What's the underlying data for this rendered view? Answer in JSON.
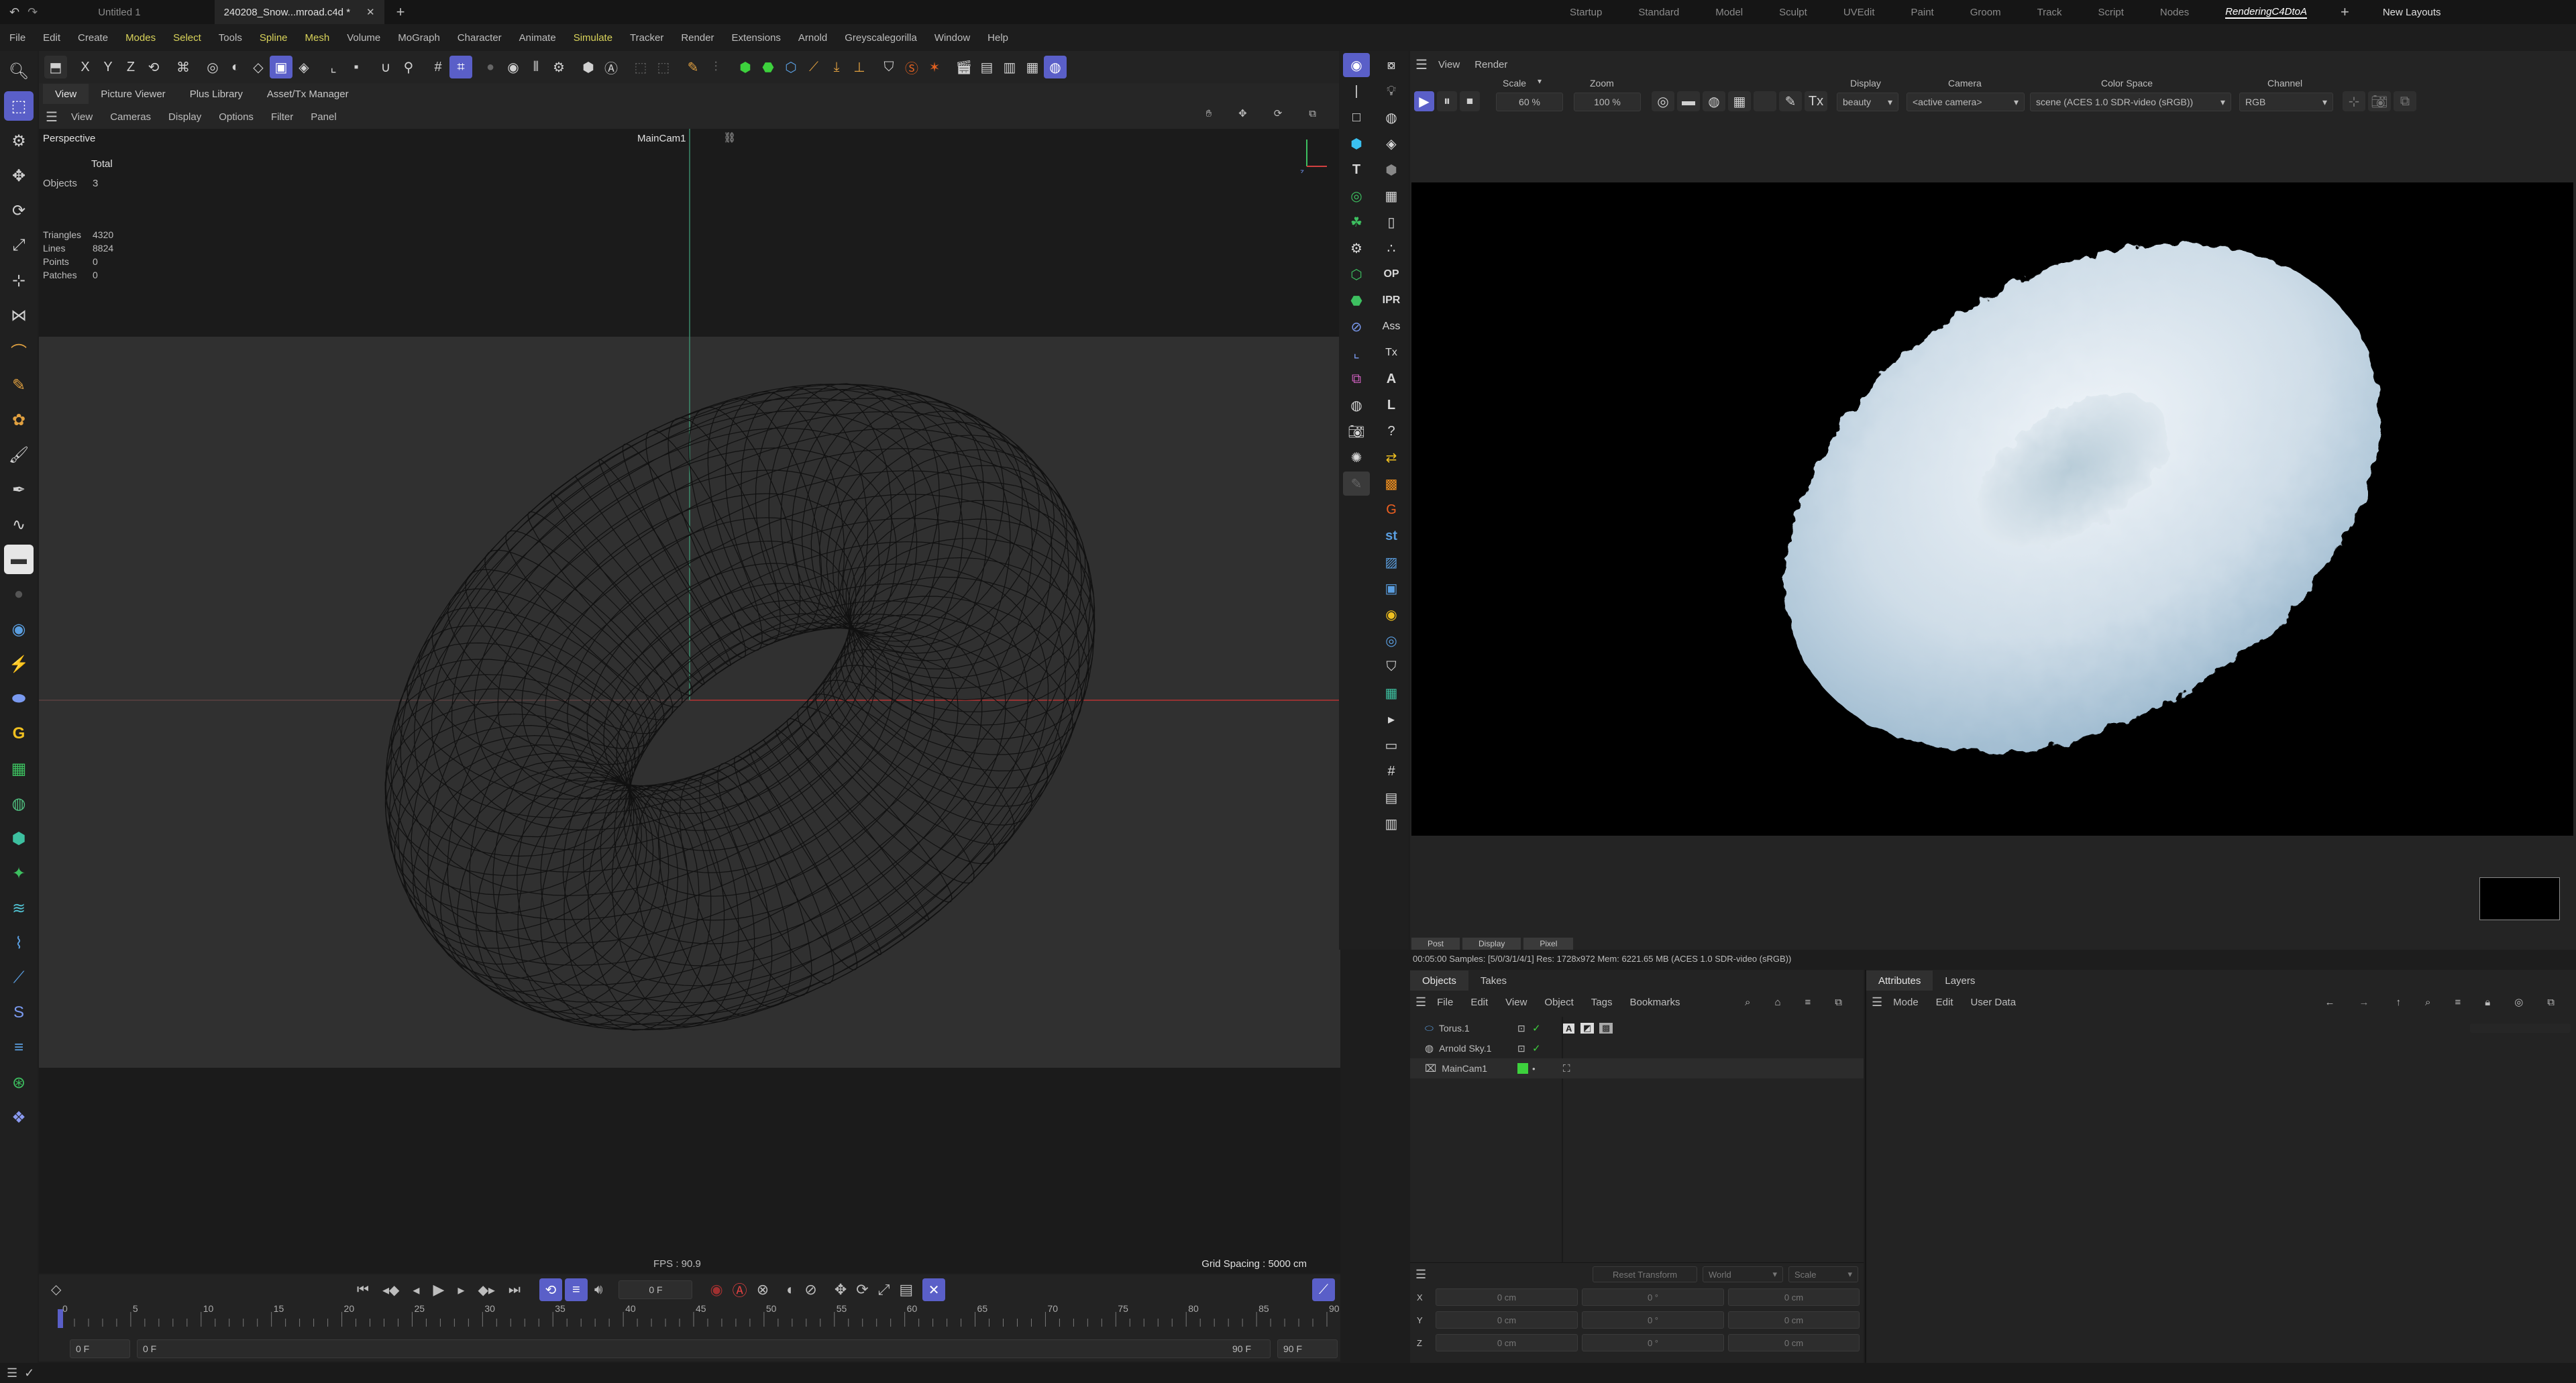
{
  "topbar": {
    "tabs": [
      "Untitled 1",
      "240208_Snow...mroad.c4d *"
    ],
    "layouts": [
      "Startup",
      "Standard",
      "Model",
      "Sculpt",
      "UVEdit",
      "Paint",
      "Groom",
      "Track",
      "Script",
      "Nodes",
      "RenderingC4DtoA"
    ],
    "active_layout": "RenderingC4DtoA",
    "new_layouts": "New Layouts"
  },
  "menubar": [
    "File",
    "Edit",
    "Create",
    "Modes",
    "Select",
    "Tools",
    "Spline",
    "Mesh",
    "Volume",
    "MoGraph",
    "Character",
    "Animate",
    "Simulate",
    "Tracker",
    "Render",
    "Extensions",
    "Arnold",
    "Greyscalegorilla",
    "Window",
    "Help"
  ],
  "toolbar_axes": [
    "X",
    "Y",
    "Z"
  ],
  "viewport": {
    "tabs": [
      "View",
      "Picture Viewer",
      "Plus Library",
      "Asset/Tx Manager"
    ],
    "menu": [
      "View",
      "Cameras",
      "Display",
      "Options",
      "Filter",
      "Panel"
    ],
    "name": "Perspective",
    "camera": "MainCam1",
    "stats_header": "Total",
    "stats": [
      {
        "label": "Objects",
        "value": "3"
      },
      {
        "label": "Triangles",
        "value": "4320"
      },
      {
        "label": "Lines",
        "value": "8824"
      },
      {
        "label": "Points",
        "value": "0"
      },
      {
        "label": "Patches",
        "value": "0"
      }
    ],
    "fps": "FPS : 90.9",
    "grid_spacing": "Grid Spacing : 5000 cm"
  },
  "timeline": {
    "current_frame": "0 F",
    "ticks": [
      "0",
      "5",
      "10",
      "15",
      "20",
      "25",
      "30",
      "35",
      "40",
      "45",
      "50",
      "55",
      "60",
      "65",
      "70",
      "75",
      "80",
      "85",
      "90"
    ],
    "start_a": "0 F",
    "start_b": "0 F",
    "end_a": "90 F",
    "end_b": "90 F"
  },
  "renderview": {
    "menu": [
      "View",
      "Render"
    ],
    "scale_label": "Scale",
    "scale_value": "60 %",
    "zoom_label": "Zoom",
    "zoom_value": "100 %",
    "display_label": "Display",
    "display_value": "beauty",
    "camera_label": "Camera",
    "camera_value": "<active camera>",
    "colorspace_label": "Color Space",
    "colorspace_value": "scene (ACES 1.0 SDR-video (sRGB))",
    "channel_label": "Channel",
    "channel_value": "RGB",
    "subtabs": [
      "Post",
      "Display",
      "Pixel"
    ],
    "status": "00:05:00  Samples: [5/0/3/1/4/1]  Res: 1728x972  Mem: 6221.65 MB  (ACES 1.0 SDR-video (sRGB))"
  },
  "objects_panel": {
    "tabs": [
      "Objects",
      "Takes"
    ],
    "menu": [
      "File",
      "Edit",
      "View",
      "Object",
      "Tags",
      "Bookmarks"
    ],
    "items": [
      "Torus.1",
      "Arnold Sky.1",
      "MainCam1"
    ]
  },
  "attributes_panel": {
    "tabs": [
      "Attributes",
      "Layers"
    ],
    "menu": [
      "Mode",
      "Edit",
      "User Data"
    ]
  },
  "coords_panel": {
    "reset": "Reset Transform",
    "space": "World",
    "mode": "Scale",
    "rows": [
      {
        "axis": "X",
        "pos": "0 cm",
        "rot": "0 °",
        "size": "0 cm"
      },
      {
        "axis": "Y",
        "pos": "0 cm",
        "rot": "0 °",
        "size": "0 cm"
      },
      {
        "axis": "Z",
        "pos": "0 cm",
        "rot": "0 °",
        "size": "0 cm"
      }
    ]
  },
  "colors": {
    "accent": "#5a5fc8",
    "menu_highlight": "#d9d35a",
    "ok_green": "#3dd13d"
  }
}
